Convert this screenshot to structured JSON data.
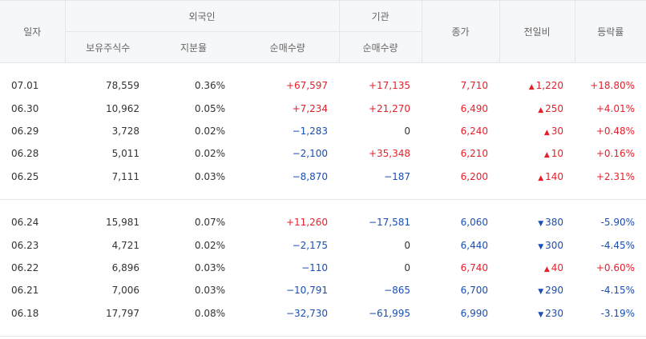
{
  "headers": {
    "date": "일자",
    "foreign": "외국인",
    "institution": "기관",
    "holdings": "보유주식수",
    "ratio": "지분율",
    "foreign_net": "순매수량",
    "inst_net": "순매수량",
    "close": "종가",
    "change": "전일비",
    "rate": "등락률"
  },
  "colors": {
    "up": "#e5202b",
    "down": "#1a4eb3"
  },
  "group1": [
    {
      "date": "07.01",
      "holdings": "78,559",
      "ratio": "0.36%",
      "foreign_net": "+67,597",
      "fn": "red",
      "inst_net": "+17,135",
      "in": "red",
      "close": "7,710",
      "cl": "red",
      "change": "1,220",
      "dir": "up",
      "rate": "+18.80%",
      "rt": "red"
    },
    {
      "date": "06.30",
      "holdings": "10,962",
      "ratio": "0.05%",
      "foreign_net": "+7,234",
      "fn": "red",
      "inst_net": "+21,270",
      "in": "red",
      "close": "6,490",
      "cl": "red",
      "change": "250",
      "dir": "up",
      "rate": "+4.01%",
      "rt": "red"
    },
    {
      "date": "06.29",
      "holdings": "3,728",
      "ratio": "0.02%",
      "foreign_net": "−1,283",
      "fn": "blue",
      "inst_net": "0",
      "in": "",
      "close": "6,240",
      "cl": "red",
      "change": "30",
      "dir": "up",
      "rate": "+0.48%",
      "rt": "red"
    },
    {
      "date": "06.28",
      "holdings": "5,011",
      "ratio": "0.02%",
      "foreign_net": "−2,100",
      "fn": "blue",
      "inst_net": "+35,348",
      "in": "red",
      "close": "6,210",
      "cl": "red",
      "change": "10",
      "dir": "up",
      "rate": "+0.16%",
      "rt": "red"
    },
    {
      "date": "06.25",
      "holdings": "7,111",
      "ratio": "0.03%",
      "foreign_net": "−8,870",
      "fn": "blue",
      "inst_net": "−187",
      "in": "blue",
      "close": "6,200",
      "cl": "red",
      "change": "140",
      "dir": "up",
      "rate": "+2.31%",
      "rt": "red"
    }
  ],
  "group2": [
    {
      "date": "06.24",
      "holdings": "15,981",
      "ratio": "0.07%",
      "foreign_net": "+11,260",
      "fn": "red",
      "inst_net": "−17,581",
      "in": "blue",
      "close": "6,060",
      "cl": "blue",
      "change": "380",
      "dir": "down",
      "rate": "-5.90%",
      "rt": "blue"
    },
    {
      "date": "06.23",
      "holdings": "4,721",
      "ratio": "0.02%",
      "foreign_net": "−2,175",
      "fn": "blue",
      "inst_net": "0",
      "in": "",
      "close": "6,440",
      "cl": "blue",
      "change": "300",
      "dir": "down",
      "rate": "-4.45%",
      "rt": "blue"
    },
    {
      "date": "06.22",
      "holdings": "6,896",
      "ratio": "0.03%",
      "foreign_net": "−110",
      "fn": "blue",
      "inst_net": "0",
      "in": "",
      "close": "6,740",
      "cl": "red",
      "change": "40",
      "dir": "up",
      "rate": "+0.60%",
      "rt": "red"
    },
    {
      "date": "06.21",
      "holdings": "7,006",
      "ratio": "0.03%",
      "foreign_net": "−10,791",
      "fn": "blue",
      "inst_net": "−865",
      "in": "blue",
      "close": "6,700",
      "cl": "blue",
      "change": "290",
      "dir": "down",
      "rate": "-4.15%",
      "rt": "blue"
    },
    {
      "date": "06.18",
      "holdings": "17,797",
      "ratio": "0.08%",
      "foreign_net": "−32,730",
      "fn": "blue",
      "inst_net": "−61,995",
      "in": "blue",
      "close": "6,990",
      "cl": "blue",
      "change": "230",
      "dir": "down",
      "rate": "-3.19%",
      "rt": "blue"
    }
  ]
}
